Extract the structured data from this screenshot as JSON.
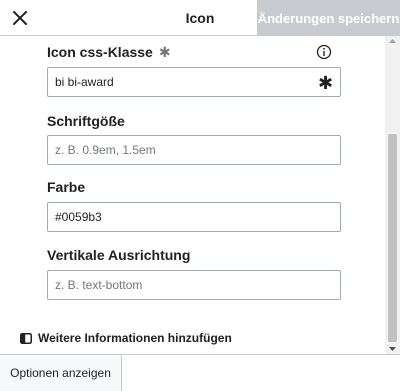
{
  "header": {
    "title": "Icon",
    "save_label": "Änderungen speichern",
    "close_icon": "close-icon"
  },
  "fields": [
    {
      "label": "Icon css-Klasse",
      "required": "✱",
      "value": "bi bi-award",
      "placeholder": "",
      "has_info": true
    },
    {
      "label": "Schriftgöße",
      "value": "",
      "placeholder": "z. B. 0.9em, 1.5em"
    },
    {
      "label": "Farbe",
      "value": "#0059b3",
      "placeholder": ""
    },
    {
      "label": "Vertikale Ausrichtung",
      "value": "",
      "placeholder": "z. B. text-bottom"
    }
  ],
  "more_info": {
    "label": "Weitere Informationen hinzufügen"
  },
  "footer": {
    "options_label": "Optionen anzeigen"
  },
  "colors": {
    "disabled_button": "#c8ccd1",
    "border": "#a2a9b1",
    "text": "#202122"
  }
}
